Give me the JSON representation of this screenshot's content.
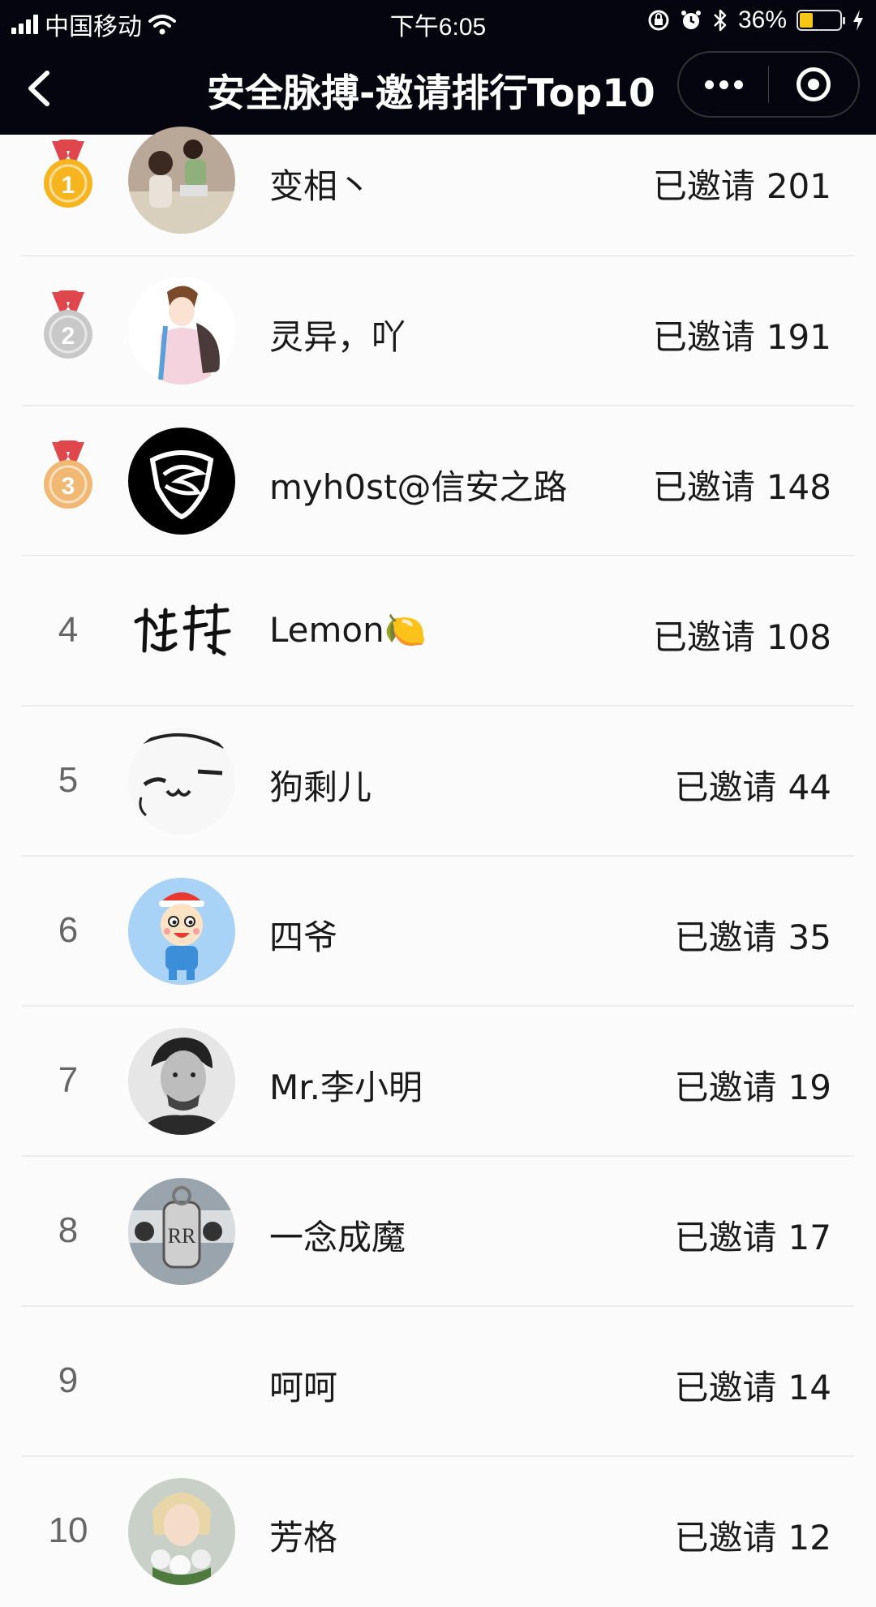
{
  "status_bar": {
    "carrier": "中国移动",
    "time": "下午6:05",
    "battery_percent": "36%",
    "battery_level": 0.36,
    "icons": [
      "signal-icon",
      "wifi-icon",
      "rotation-lock-icon",
      "alarm-icon",
      "bluetooth-icon",
      "battery-icon",
      "charging-icon"
    ]
  },
  "navbar": {
    "title": "安全脉搏-邀请排行Top10",
    "back_icon": "chevron-left-icon",
    "more_icon": "more-dots-icon",
    "close_icon": "target-circle-icon"
  },
  "colors": {
    "bar_bg": "#050510",
    "list_bg": "#fbfbfb",
    "gold": "#f6b51e",
    "silver": "#c8c8c8",
    "bronze": "#f0b873",
    "ribbon": "#e0474c"
  },
  "invite_prefix": "已邀请",
  "leaderboard": [
    {
      "rank": "1",
      "medal": "gold",
      "name": "变相丶",
      "count": "201",
      "avatar": "photo-avatar"
    },
    {
      "rank": "2",
      "medal": "silver",
      "name": "灵异，吖",
      "count": "191",
      "avatar": "anime-avatar"
    },
    {
      "rank": "3",
      "medal": "bronze",
      "name": "myh0st@信安之路",
      "count": "148",
      "avatar": "logo-avatar"
    },
    {
      "rank": "4",
      "medal": "",
      "name": "Lemon🍋",
      "count": "108",
      "avatar": "calligraphy-avatar"
    },
    {
      "rank": "5",
      "medal": "",
      "name": "狗剩儿",
      "count": "44",
      "avatar": "cartoon-face-avatar"
    },
    {
      "rank": "6",
      "medal": "",
      "name": "四爷",
      "count": "35",
      "avatar": "cartoon-boy-avatar"
    },
    {
      "rank": "7",
      "medal": "",
      "name": "Mr.李小明",
      "count": "19",
      "avatar": "portrait-avatar"
    },
    {
      "rank": "8",
      "medal": "",
      "name": "一念成魔",
      "count": "17",
      "avatar": "car-key-avatar"
    },
    {
      "rank": "9",
      "medal": "",
      "name": "呵呵",
      "count": "14",
      "avatar": "blank-avatar"
    },
    {
      "rank": "10",
      "medal": "",
      "name": "芳格",
      "count": "12",
      "avatar": "flower-portrait-avatar"
    }
  ]
}
